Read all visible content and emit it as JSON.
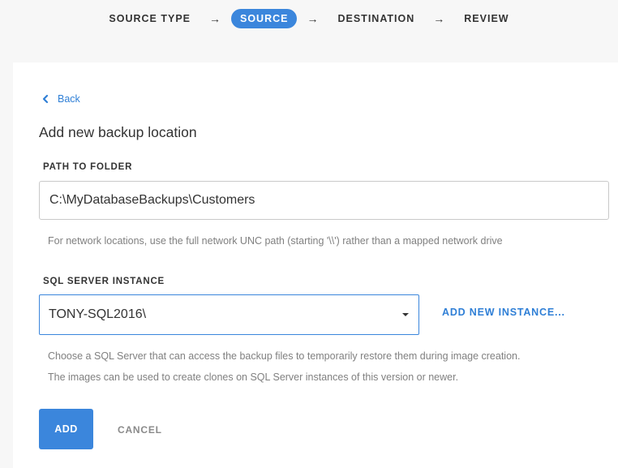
{
  "stepper": {
    "steps": [
      "SOURCE TYPE",
      "SOURCE",
      "DESTINATION",
      "REVIEW"
    ],
    "active_index": 1,
    "separator": "→"
  },
  "back": {
    "label": "Back",
    "icon": "chevron-left-icon"
  },
  "form": {
    "title": "Add new backup location",
    "path": {
      "label": "PATH TO FOLDER",
      "value": "C:\\MyDatabaseBackups\\Customers",
      "hint": "For network locations, use the full network UNC path (starting '\\\\') rather than a mapped network drive"
    },
    "instance": {
      "label": "SQL SERVER INSTANCE",
      "selected": "TONY-SQL2016\\",
      "add_new_label": "ADD NEW INSTANCE...",
      "hint_line1": "Choose a SQL Server that can access the backup files to temporarily restore them during image creation.",
      "hint_line2": "The images can be used to create clones on SQL Server instances of this version or newer."
    },
    "actions": {
      "add_label": "ADD",
      "cancel_label": "CANCEL"
    }
  },
  "colors": {
    "accent": "#3b86dc",
    "link": "#2f7fd6",
    "hint": "#808080"
  }
}
